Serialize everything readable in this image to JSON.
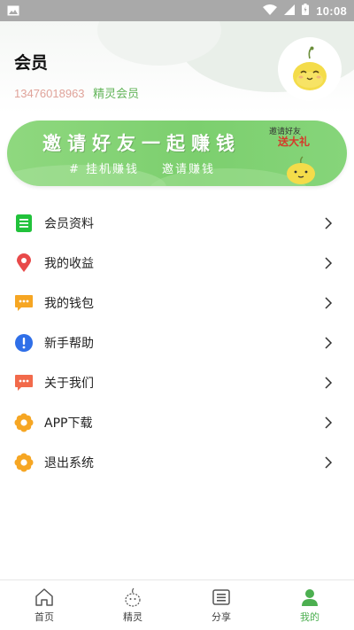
{
  "status_bar": {
    "time": "10:08",
    "colors": {
      "bg": "#a9a9a9"
    }
  },
  "header": {
    "title": "会员",
    "phone": "13476018963",
    "level": "精灵会员"
  },
  "banner": {
    "title": "邀请好友一起赚钱",
    "sub_left": "# 挂机赚钱",
    "sub_right": "邀请赚钱",
    "badge_line1": "邀请好友",
    "badge_line2": "送大礼"
  },
  "menu": [
    {
      "label": "会员资料",
      "icon": "document-icon"
    },
    {
      "label": "我的收益",
      "icon": "location-pin-icon"
    },
    {
      "label": "我的钱包",
      "icon": "chat-bubble-icon"
    },
    {
      "label": "新手帮助",
      "icon": "info-icon"
    },
    {
      "label": "关于我们",
      "icon": "message-icon"
    },
    {
      "label": "APP下载",
      "icon": "flower-icon"
    },
    {
      "label": "退出系统",
      "icon": "flower-icon"
    }
  ],
  "nav": [
    {
      "label": "首页",
      "icon": "home-icon"
    },
    {
      "label": "精灵",
      "icon": "sprite-icon"
    },
    {
      "label": "分享",
      "icon": "share-icon"
    },
    {
      "label": "我的",
      "icon": "user-icon",
      "active": true
    }
  ],
  "colors": {
    "accent": "#4caf50",
    "phone": "#e0a39a",
    "level": "#63b55a",
    "banner": "#7ccf6e"
  }
}
